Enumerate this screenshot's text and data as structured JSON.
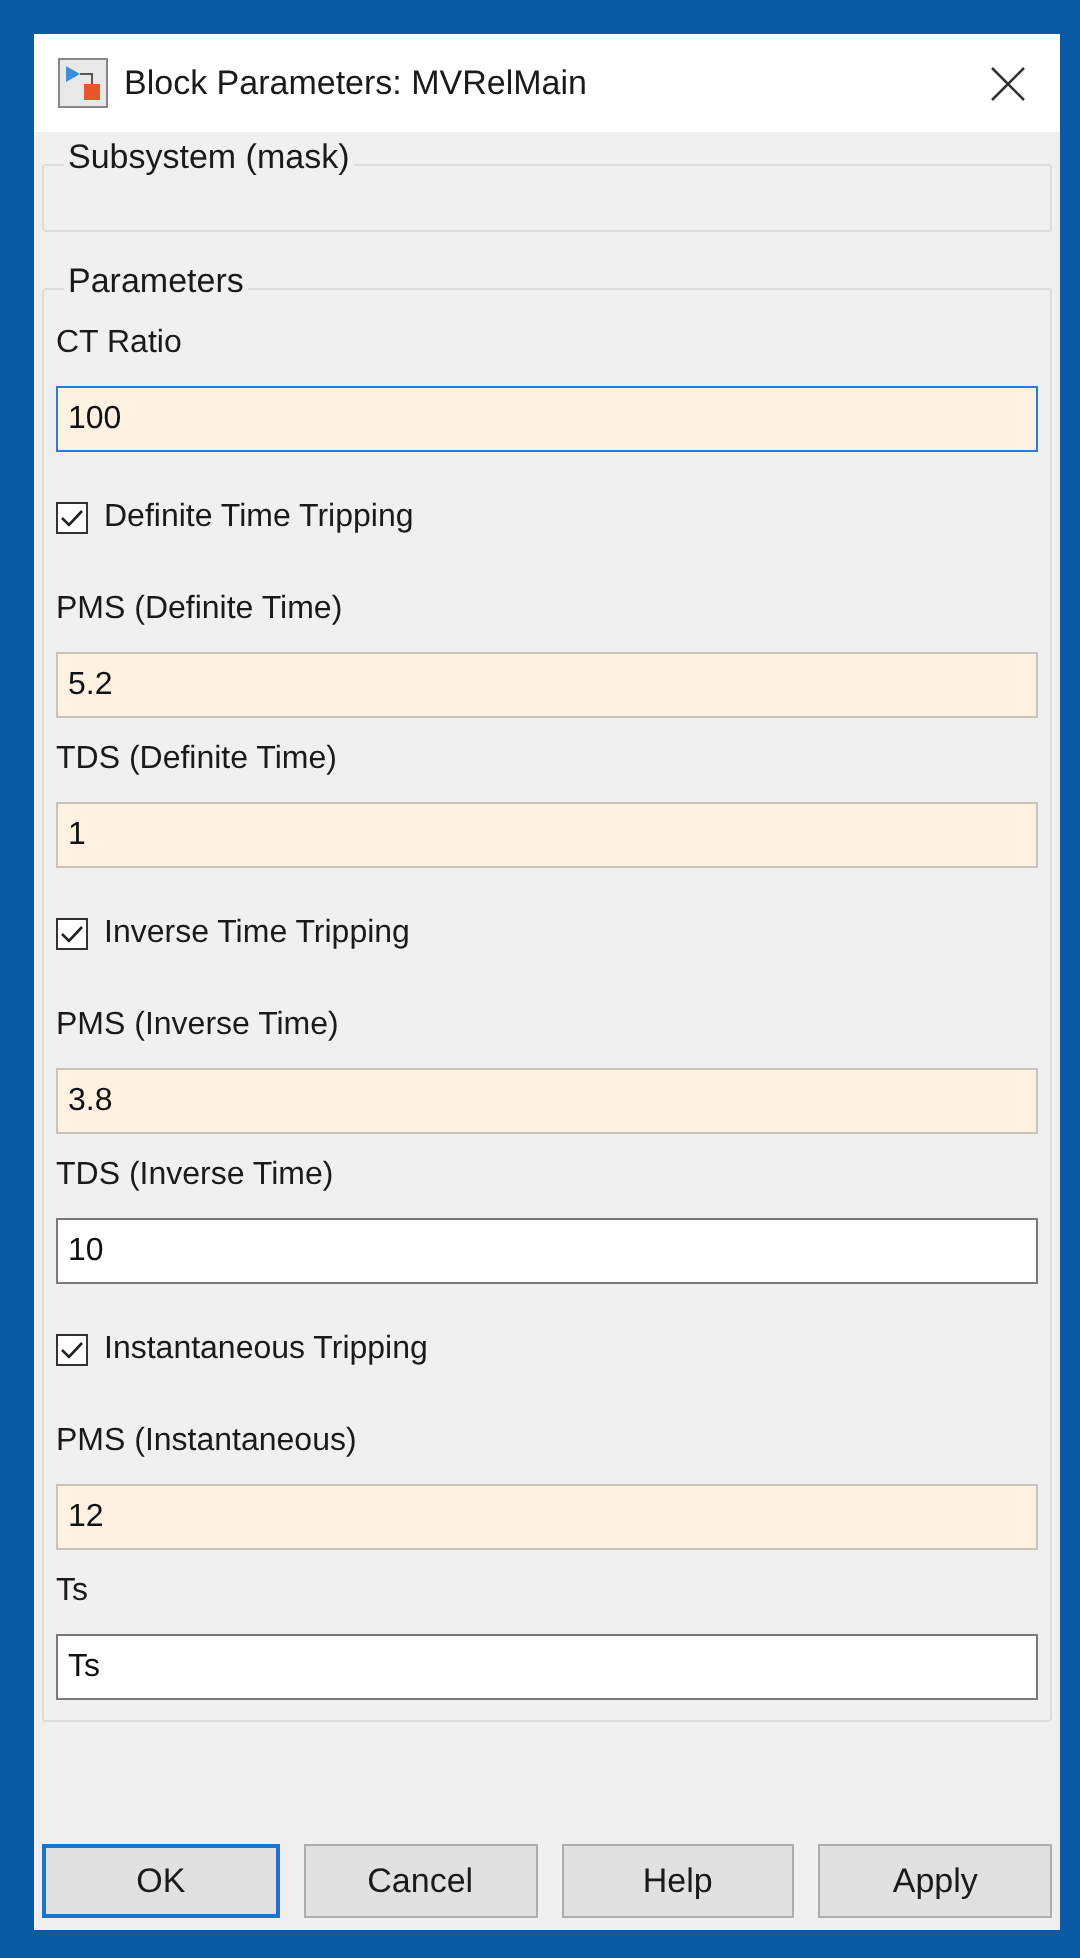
{
  "window": {
    "title": "Block Parameters: MVRelMain"
  },
  "description_group": {
    "title": "Subsystem (mask)"
  },
  "parameters_group": {
    "title": "Parameters",
    "items": [
      {
        "kind": "field",
        "label": "CT Ratio",
        "value": "100",
        "highlighted": true,
        "focused": true
      },
      {
        "kind": "checkbox",
        "label": "Definite Time Tripping",
        "checked": true
      },
      {
        "kind": "field",
        "label": "PMS (Definite Time)",
        "value": "5.2",
        "highlighted": true,
        "focused": false
      },
      {
        "kind": "field",
        "label": "TDS (Definite Time)",
        "value": "1",
        "highlighted": true,
        "focused": false
      },
      {
        "kind": "checkbox",
        "label": "Inverse Time Tripping",
        "checked": true
      },
      {
        "kind": "field",
        "label": "PMS (Inverse Time)",
        "value": "3.8",
        "highlighted": true,
        "focused": false
      },
      {
        "kind": "field",
        "label": "TDS (Inverse Time)",
        "value": "10",
        "highlighted": false,
        "focused": false
      },
      {
        "kind": "checkbox",
        "label": "Instantaneous Tripping",
        "checked": true
      },
      {
        "kind": "field",
        "label": "PMS (Instantaneous)",
        "value": "12",
        "highlighted": true,
        "focused": false
      },
      {
        "kind": "field",
        "label": "Ts",
        "value": "Ts",
        "highlighted": false,
        "focused": false
      }
    ]
  },
  "buttons": [
    {
      "label": "OK",
      "default": true
    },
    {
      "label": "Cancel",
      "default": false
    },
    {
      "label": "Help",
      "default": false
    },
    {
      "label": "Apply",
      "default": false
    }
  ]
}
